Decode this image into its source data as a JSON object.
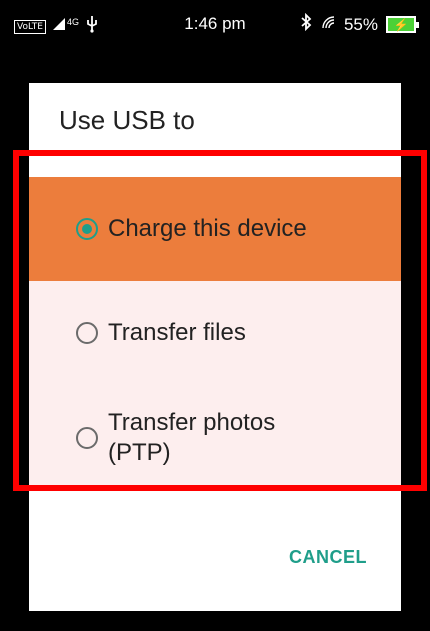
{
  "status_bar": {
    "volte": "VoLTE",
    "network": "4G",
    "usb_icon": "usb-icon",
    "time": "1:46 pm",
    "bluetooth_icon": "bluetooth-icon",
    "signal_icon": "signal-icon",
    "battery": "55%",
    "battery_icon": "battery-charging-icon"
  },
  "dialog": {
    "title": "Use USB to",
    "options": [
      {
        "label": "Charge this device",
        "selected": true
      },
      {
        "label": "Transfer files",
        "selected": false
      },
      {
        "label": "Transfer photos (PTP)",
        "selected": false
      }
    ],
    "cancel_label": "CANCEL"
  },
  "colors": {
    "selected_row": "#ec7d3c",
    "unselected_row": "#fdeeee",
    "accent": "#1f9e8a",
    "highlight_box": "#ff0000"
  }
}
